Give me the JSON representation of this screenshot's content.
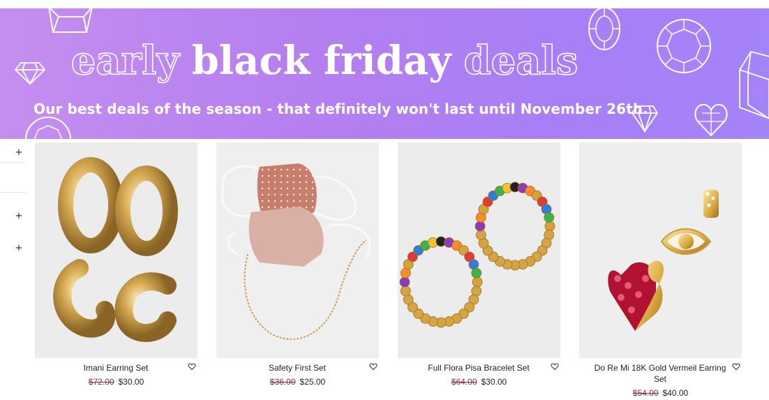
{
  "banner": {
    "headline_early": "early",
    "headline_black_friday": "black friday",
    "headline_deals": "deals",
    "subline": "Our best deals of the season - that definitely won't last until November 26th.",
    "background_start": "#c58ef0",
    "background_end": "#a583f9"
  },
  "filters": {
    "items": [
      {
        "icon": "plus-icon",
        "symbol": "+"
      },
      {
        "icon": "plus-icon",
        "symbol": "+"
      },
      {
        "icon": "plus-icon",
        "symbol": "+"
      }
    ]
  },
  "products": [
    {
      "name": "Imani Earring Set",
      "old_price": "$72.00",
      "price": "$30.00",
      "image": "gold-hoop-earrings-image"
    },
    {
      "name": "Safety First Set",
      "old_price": "$36.00",
      "price": "$25.00",
      "image": "face-masks-with-chain-image"
    },
    {
      "name": "Full Flora Pisa Bracelet Set",
      "old_price": "$64.00",
      "price": "$30.00",
      "image": "beaded-bracelets-image"
    },
    {
      "name": "Do Re Mi 18K Gold Vermeil Earring Set",
      "old_price": "$54.00",
      "price": "$40.00",
      "image": "heart-eye-stud-earrings-image"
    }
  ],
  "colors": {
    "old_price": "#8a2e3b",
    "text": "#222222",
    "image_bg": "#ededed"
  }
}
